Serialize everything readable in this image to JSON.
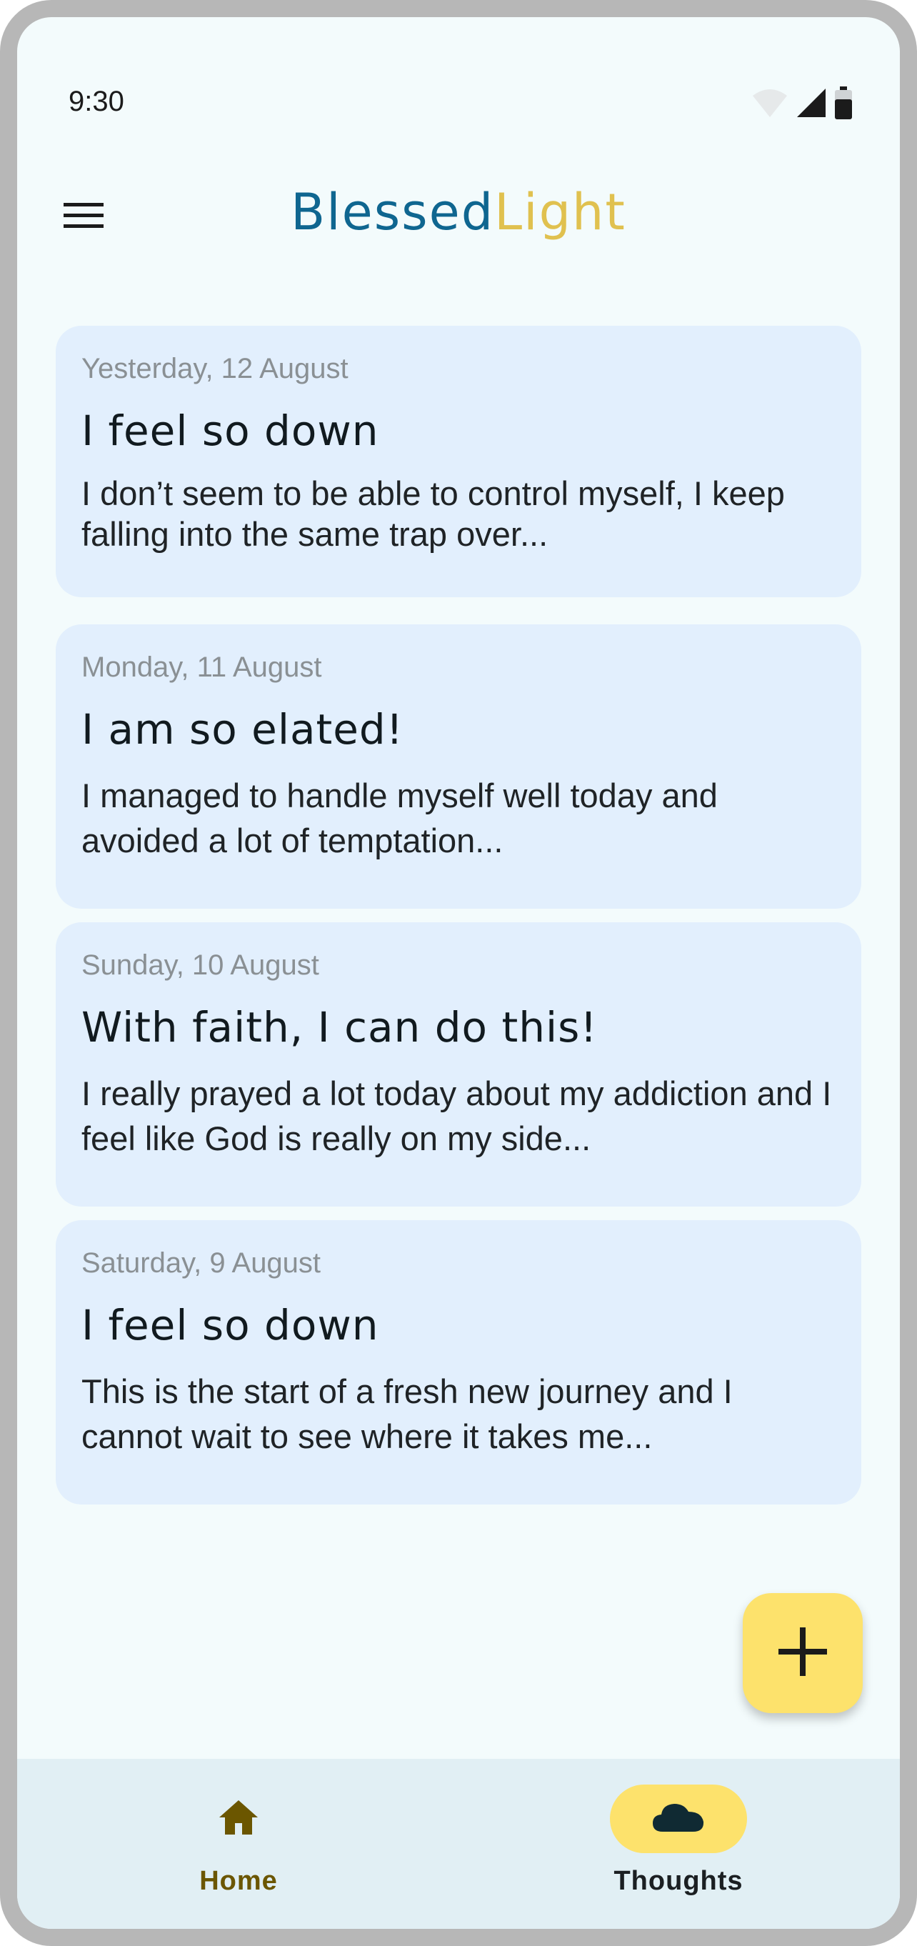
{
  "status_bar": {
    "time": "9:30",
    "icons": [
      "wifi-icon",
      "cell-signal-icon",
      "battery-icon"
    ]
  },
  "app_bar": {
    "menu_icon": "hamburger-menu-icon",
    "brand_part1": "Blessed",
    "brand_part2": "Light"
  },
  "colors": {
    "brand_blue": "#0f6690",
    "brand_gold": "#e0c14f",
    "card_background": "#e2effd",
    "accent_yellow": "#fde26c",
    "nav_background": "#e1eff4"
  },
  "entries": [
    {
      "date": "Yesterday, 12 August",
      "title": "I feel so down",
      "excerpt": "I don’t seem to be able to control myself, I keep falling into the same trap over..."
    },
    {
      "date": "Monday, 11 August",
      "title": "I am so elated!",
      "excerpt": "I managed to handle myself well today and avoided a lot of temptation..."
    },
    {
      "date": "Sunday, 10 August",
      "title": "With faith, I can do this!",
      "excerpt": "I really prayed a lot today about my addiction and I feel like God is really on my side..."
    },
    {
      "date": "Saturday, 9 August",
      "title": "I feel so down",
      "excerpt": "This is the start of a fresh new journey and I cannot wait to see where it takes me..."
    }
  ],
  "fab": {
    "icon": "plus-icon"
  },
  "bottom_nav": {
    "items": [
      {
        "label": "Home",
        "icon": "home-icon",
        "active": false
      },
      {
        "label": "Thoughts",
        "icon": "cloud-icon",
        "active": true
      }
    ]
  }
}
